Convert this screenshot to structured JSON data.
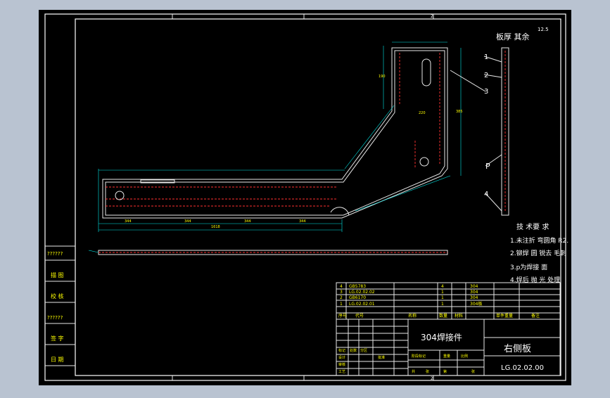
{
  "colors": {
    "app_background": "#b9c3d1",
    "paper": "#000000",
    "border": "#ffffff",
    "dimension": "#00e6e6",
    "centerline": "#ff3030",
    "text_yellow": "#ffff00",
    "text_white": "#ffffff"
  },
  "frame": {
    "zone_labels": [
      "1",
      "2"
    ]
  },
  "drawing": {
    "top_right_title": "板厚 其余",
    "roughness": "12.5",
    "callouts": [
      "1",
      "2",
      "3",
      "P",
      "4"
    ],
    "side_callout": "3",
    "overall_length": "1618",
    "segment_dims": [
      "344",
      "344",
      "344",
      "344",
      "190",
      "220"
    ],
    "height_dim": "385"
  },
  "technical_requirements": {
    "title": "技 术要 求",
    "items": [
      "1.未注折 弯圆角 R2.",
      "2.铆焊 圆 锐去 毛刺",
      "3.p为焊接 面",
      "4.焊后 抛 光 处理"
    ]
  },
  "parts_list": {
    "rows": [
      {
        "no": "4",
        "code": "GB5783",
        "qty": "4",
        "material": "304"
      },
      {
        "no": "3",
        "code": "LG.02.02.02",
        "qty": "1",
        "material": "304"
      },
      {
        "no": "2",
        "code": "GB6170",
        "qty": "1",
        "material": "304"
      },
      {
        "no": "1",
        "code": "LG.02.02.01",
        "qty": "1",
        "material": "304板"
      }
    ],
    "header": [
      "序号",
      "代号",
      "名称",
      "数量",
      "材料",
      "单件重量",
      "备注"
    ]
  },
  "title_block": {
    "material": "304焊接件",
    "part_name": "右侧板",
    "drawing_number": "LG.02.02.00",
    "cells": [
      "标记",
      "处数",
      "分区",
      "设计",
      "审核",
      "工艺",
      "批准",
      "阶段标记",
      "重量",
      "比例",
      "共",
      "张",
      "第",
      "张"
    ]
  },
  "left_strip": {
    "labels": [
      "??????",
      "描 图",
      "校 核",
      "??????",
      "签 字",
      "日 期"
    ]
  }
}
